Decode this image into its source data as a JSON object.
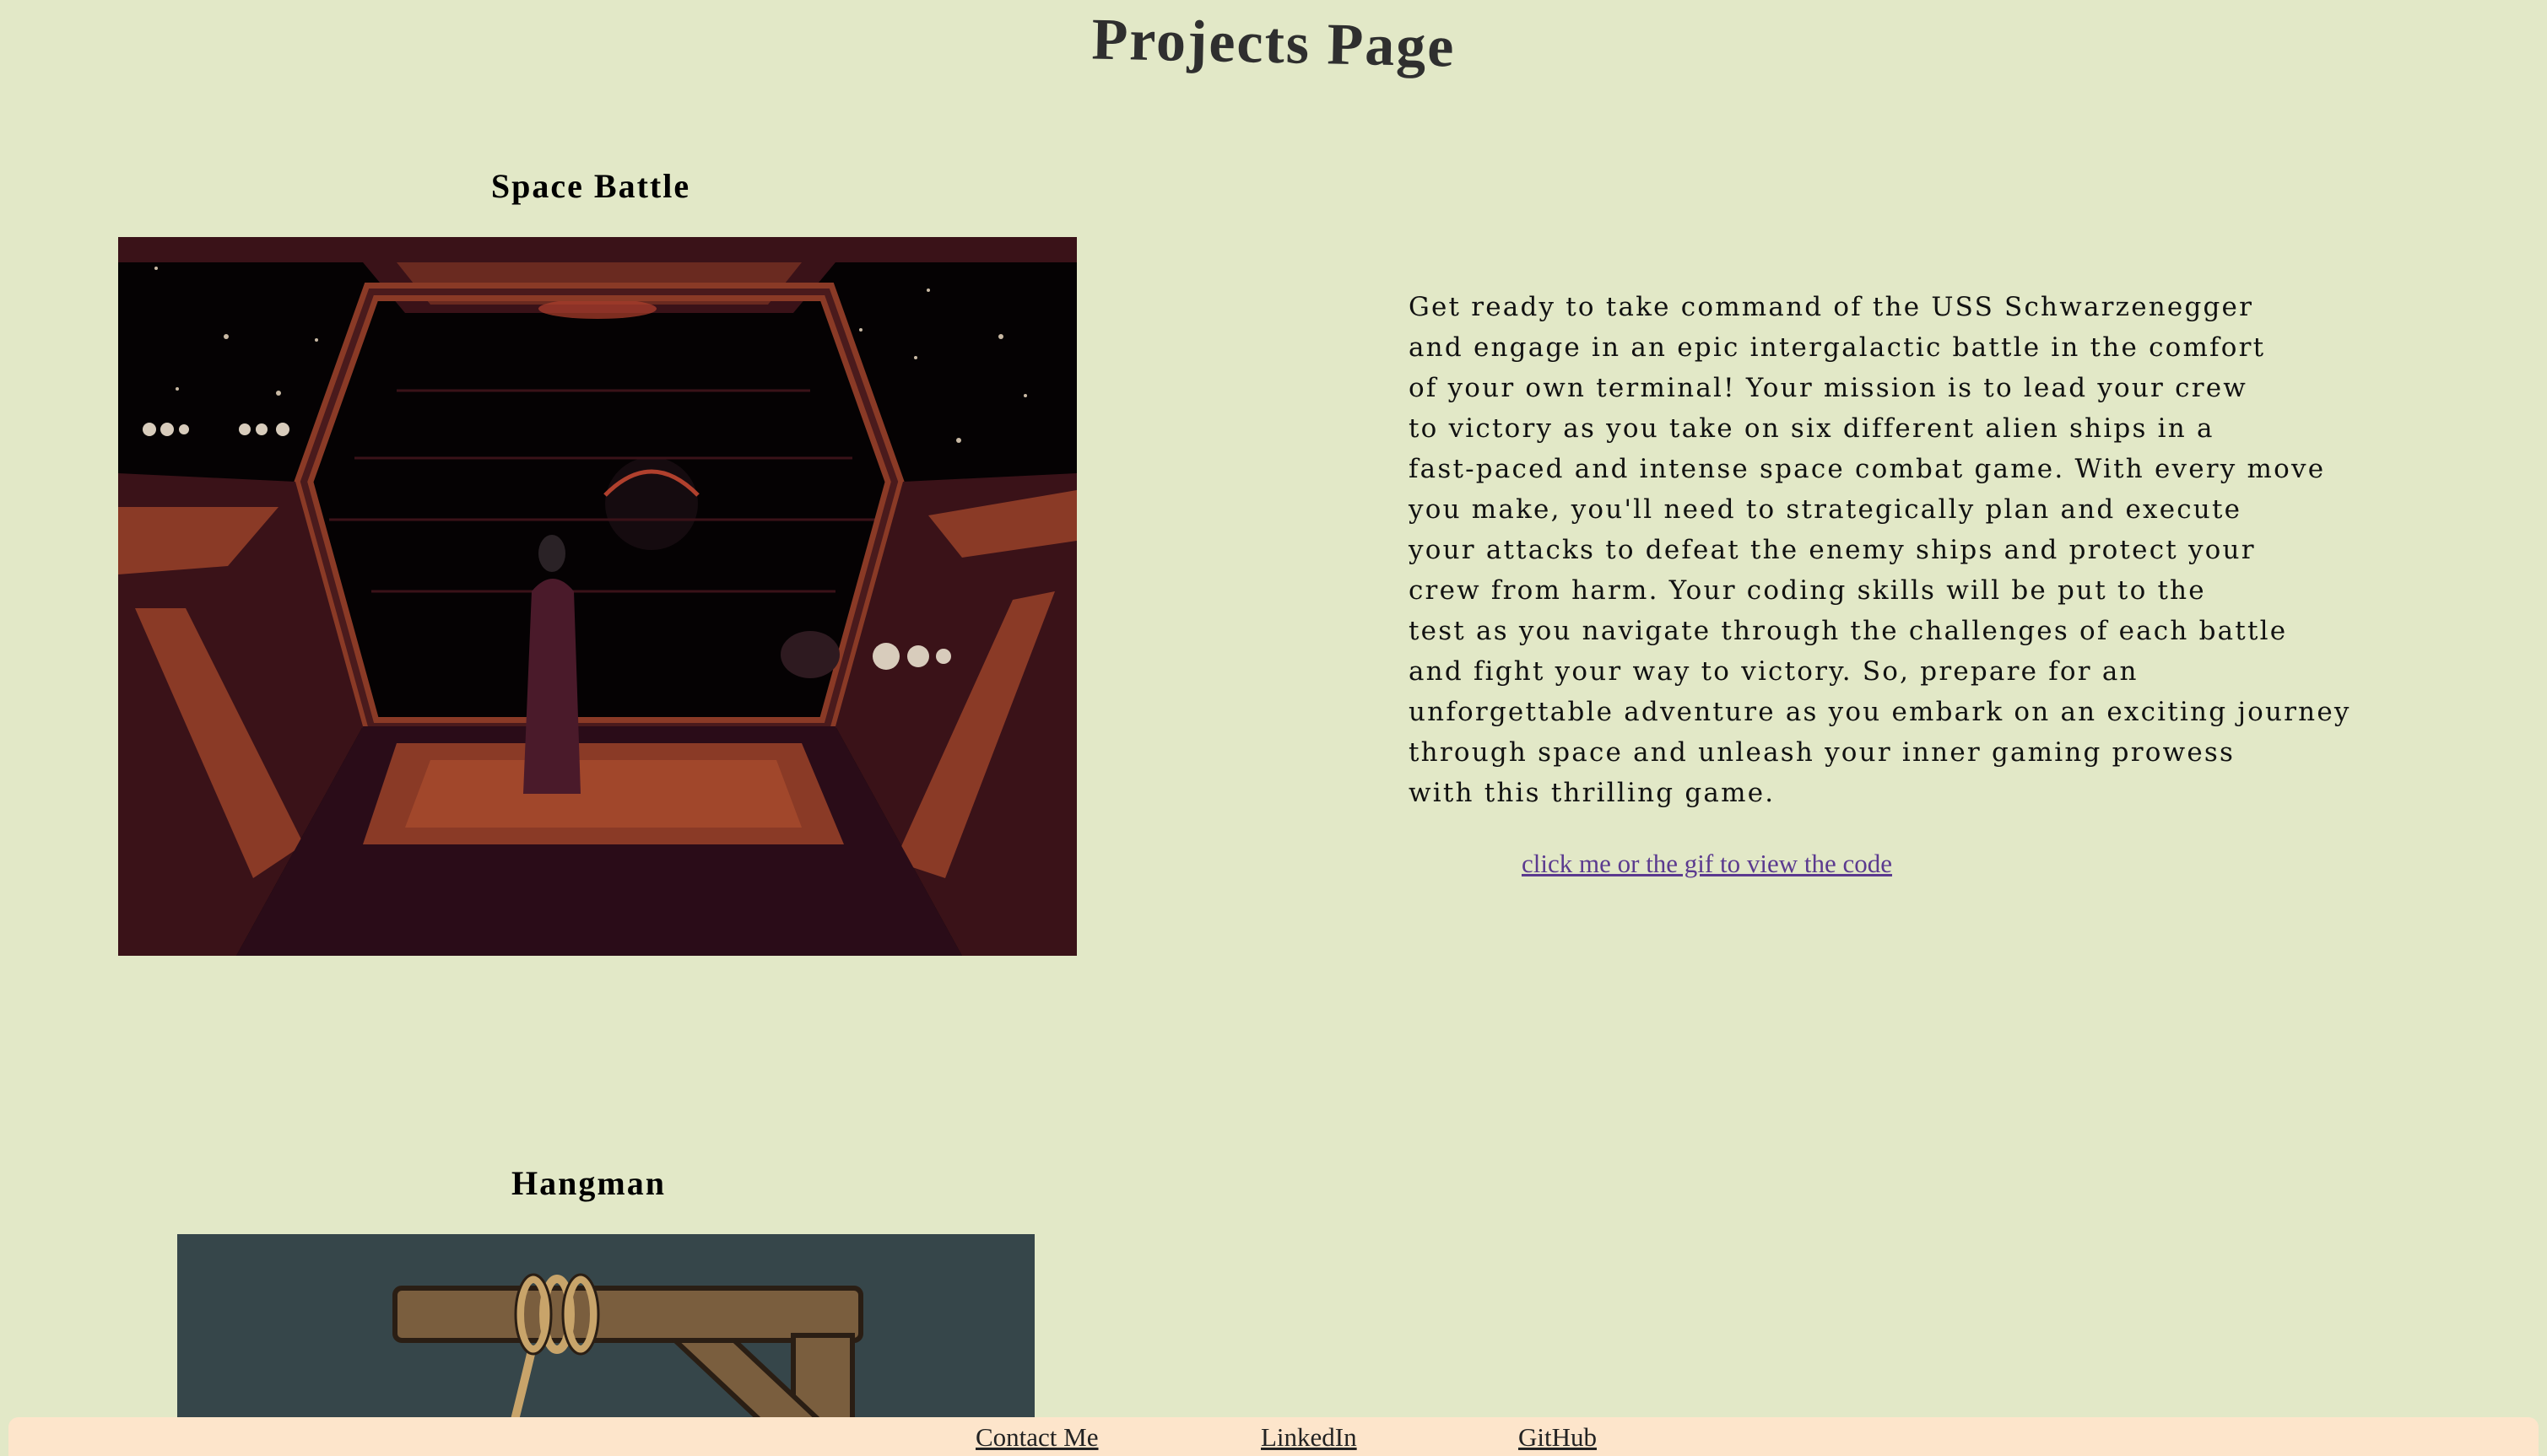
{
  "page": {
    "title": "Projects Page"
  },
  "projects": [
    {
      "heading": "Space Battle",
      "description_lines": [
        "Get ready to take command of the USS Schwarzenegger",
        "and engage in an epic intergalactic battle in the comfort",
        "of your own terminal! Your mission is to lead your crew",
        "to victory as you take on six different alien ships in a",
        "fast-paced and intense space combat game. With every move",
        "you make, you'll need to strategically plan and execute",
        "your attacks to defeat the enemy ships and protect your",
        "crew from harm. Your coding skills will be put to the",
        "test as you navigate through the challenges of each battle",
        "and fight your way to victory. So, prepare for an",
        "unforgettable adventure as you embark on an exciting journey",
        "through space and unleash your inner gaming prowess",
        "with this thrilling game."
      ],
      "link_label": "click me or the gif to view the code"
    },
    {
      "heading": "Hangman"
    }
  ],
  "footer": {
    "links": [
      "Contact Me",
      "LinkedIn",
      "GitHub"
    ]
  },
  "colors": {
    "background": "#e2e8c7",
    "footer_background": "#fde5cb",
    "link_visited": "#5b3a8f"
  }
}
